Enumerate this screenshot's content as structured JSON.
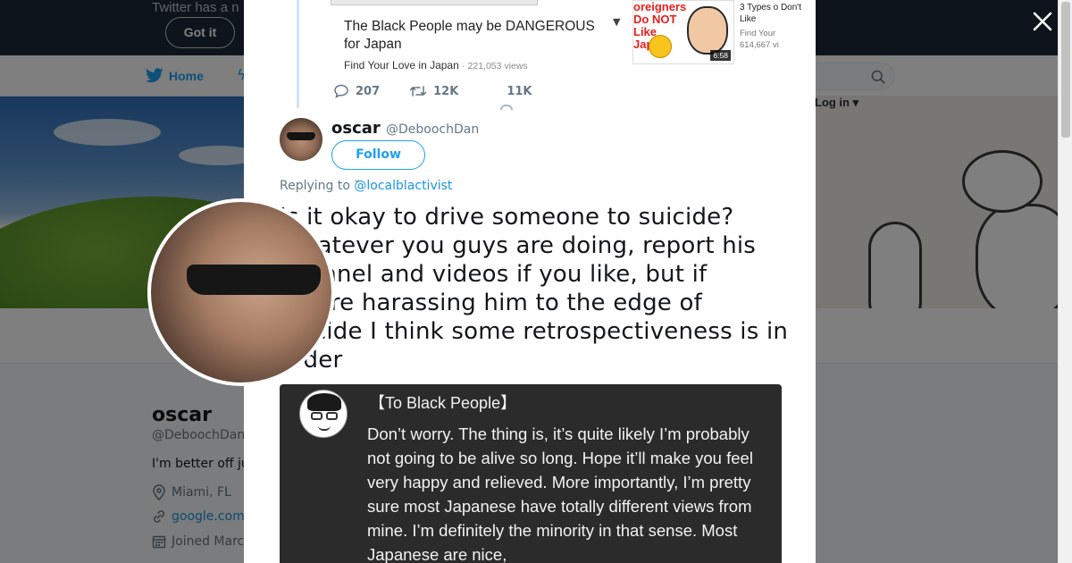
{
  "banner": {
    "text": "Twitter has a n",
    "got_it_label": "Got it"
  },
  "nav": {
    "home_label": "Home",
    "login_label": "Log in"
  },
  "profile": {
    "name": "oscar",
    "handle": "@DeboochDan",
    "bio": "I'm better off ju",
    "location": "Miami, FL",
    "website": "google.com",
    "joined": "Joined Marc"
  },
  "quoted_video": {
    "title": "The Black People may be DANGEROUS for Japan",
    "channel": "Find Your Love in Japan",
    "views": "221,053 views",
    "thumbnail_text": "oreigners Do NOT Like Japan",
    "duration": "6:58",
    "side_title": "3 Types o Don't Like",
    "side_channel": "Find Your",
    "side_views": "614,667 vi"
  },
  "quoted_actions": {
    "replies": "207",
    "retweets": "12K",
    "likes": "11K"
  },
  "tweet": {
    "author_name": "oscar",
    "author_handle": "@DeboochDan",
    "follow_label": "Follow",
    "replying_prefix": "Replying to",
    "replying_to": "@localblactivist",
    "text": "Is it okay to drive someone to suicide? Whatever you guys are doing, report his channel and videos if you like, but if you’re harassing him to the edge of suicide I think some retrospectiveness is in order"
  },
  "media": {
    "title": "【To Black People】",
    "body": "Don’t worry. The thing is, it’s quite likely I’m probably not going to be alive so long. Hope it’ll make you feel very happy and relieved. More importantly, I’m pretty sure most Japanese have totally different views from mine. I’m definitely the minority in that sense. Most Japanese are nice,"
  },
  "colors": {
    "accent": "#1da1f2",
    "link": "#1b95e0",
    "text_primary": "#14171a",
    "text_secondary": "#657786",
    "overlay": "rgba(0,0,0,0.5)",
    "banner_bg": "#1c2938",
    "media_bg": "#2b2b2b"
  },
  "icons": {
    "close": "close-icon",
    "reply": "reply-icon",
    "retweet": "retweet-icon",
    "like": "heart-icon",
    "twitter": "twitter-bird-icon",
    "search": "search-icon",
    "location": "location-pin-icon",
    "link": "link-icon",
    "calendar": "calendar-icon"
  }
}
